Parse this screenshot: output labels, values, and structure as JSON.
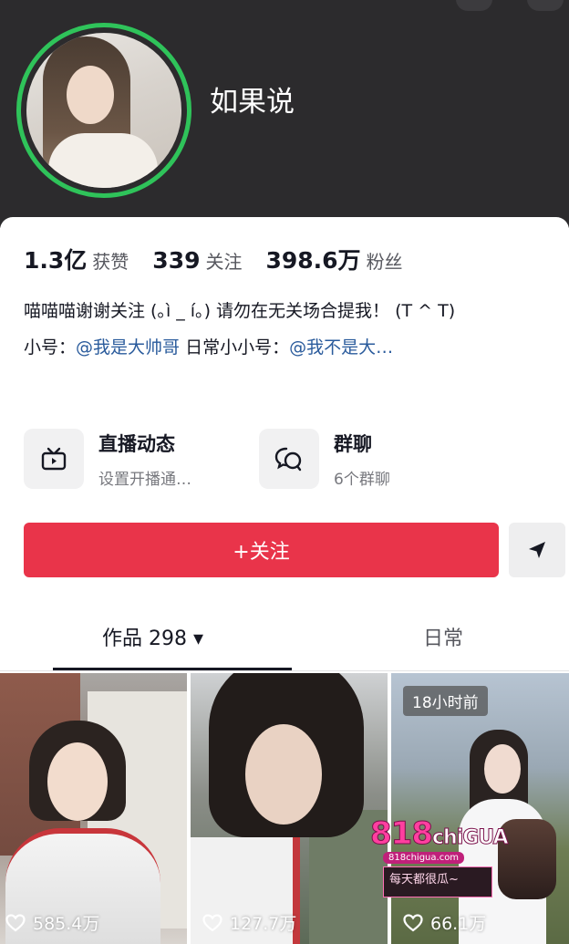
{
  "profile": {
    "username": "如果说",
    "stats": [
      {
        "value": "1.3亿",
        "label": "获赞"
      },
      {
        "value": "339",
        "label": "关注"
      },
      {
        "value": "398.6万",
        "label": "粉丝"
      }
    ],
    "bio_line1": "喵喵喵谢谢关注 (｡ì _ í｡) 请勿在无关场合提我！ (T ^ T)",
    "bio_line2_prefix": "小号：",
    "bio_line2_mention1": "@我是大帅哥",
    "bio_line2_middle": " 日常小小号：",
    "bio_line2_mention2": "@我不是大…"
  },
  "features": [
    {
      "title": "直播动态",
      "subtitle": "设置开播通…",
      "icon": "tv-icon"
    },
    {
      "title": "群聊",
      "subtitle": "6个群聊",
      "icon": "chat-bubbles-icon"
    }
  ],
  "actions": {
    "follow_label": "+关注",
    "share_icon": "send-icon"
  },
  "tabs": {
    "works_label": "作品 298 ▾",
    "daily_label": "日常"
  },
  "videos": [
    {
      "likes": "585.4万"
    },
    {
      "likes": "127.7万"
    },
    {
      "likes": "66.1万",
      "time_badge": "18小时前"
    }
  ],
  "watermark": {
    "logo": "818",
    "logo_suffix": "chiGUA",
    "url": "818chigua.com",
    "banner": "每天都很瓜~"
  },
  "colors": {
    "header_bg": "#2c2b2d",
    "avatar_ring": "#2fc35a",
    "follow_button": "#e9344a",
    "mention": "#2a5b9c"
  }
}
